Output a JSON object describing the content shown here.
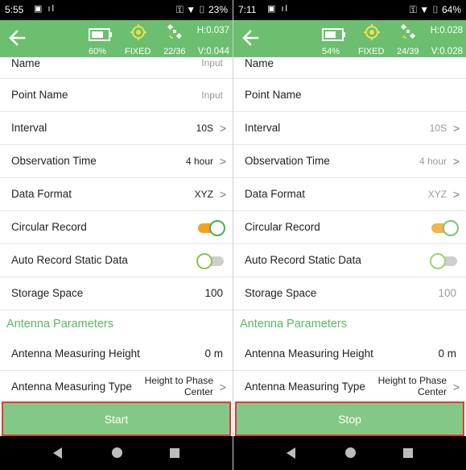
{
  "colors": {
    "accent": "#6bbf6f",
    "toggle_on": "#f4a21e",
    "highlight": "#e53935",
    "section": "#5cb860"
  },
  "left": {
    "status": {
      "time": "5:55",
      "right": "23%"
    },
    "header": {
      "battery": "60%",
      "fix": "FIXED",
      "sats": "22/36",
      "h_acc": "H:0.037",
      "v_acc": "V:0.044"
    },
    "rows": {
      "name_label": "Name",
      "name_value": "Input",
      "point_name_label": "Point Name",
      "point_name_value": "Input",
      "interval_label": "Interval",
      "interval_value": "10S",
      "obs_label": "Observation Time",
      "obs_value": "4 hour",
      "format_label": "Data Format",
      "format_value": "XYZ",
      "circular_label": "Circular Record",
      "auto_label": "Auto Record Static Data",
      "storage_label": "Storage Space",
      "storage_value": "100",
      "section_label": "Antenna Parameters",
      "height_label": "Antenna Measuring Height",
      "height_value": "0 m",
      "type_label": "Antenna Measuring Type",
      "type_value_1": "Height to Phase",
      "type_value_2": "Center"
    },
    "circular_on": true,
    "auto_on": false,
    "button": "Start"
  },
  "right": {
    "status": {
      "time": "7:11",
      "right": "64%"
    },
    "header": {
      "battery": "54%",
      "fix": "FIXED",
      "sats": "24/39",
      "h_acc": "H:0.028",
      "v_acc": "V:0.028"
    },
    "rows": {
      "name_label": "Name",
      "point_name_label": "Point Name",
      "interval_label": "Interval",
      "interval_value": "10S",
      "obs_label": "Observation Time",
      "obs_value": "4 hour",
      "format_label": "Data Format",
      "format_value": "XYZ",
      "circular_label": "Circular Record",
      "auto_label": "Auto Record Static Data",
      "storage_label": "Storage Space",
      "storage_value": "100",
      "section_label": "Antenna Parameters",
      "height_label": "Antenna Measuring Height",
      "height_value": "0 m",
      "type_label": "Antenna Measuring Type",
      "type_value_1": "Height to Phase",
      "type_value_2": "Center"
    },
    "circular_on": true,
    "auto_on": false,
    "button": "Stop"
  }
}
